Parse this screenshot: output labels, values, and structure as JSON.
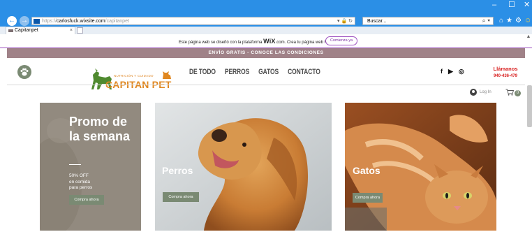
{
  "browser": {
    "url_scheme": "https://",
    "url_host": "carlosfuck.wixsite.com",
    "url_path": "/capitanpet",
    "search_placeholder": "Buscar...",
    "tab_title": "Capitanpet",
    "tab_close": "×",
    "win_min": "–",
    "win_max": "☐",
    "win_close": "✕",
    "addr_icons": "▾ 🔒 ↻",
    "search_icon": "⌕ ▾",
    "home_icon": "⌂",
    "star_icon": "★",
    "gear_icon": "⚙",
    "smiley_icon": "☺",
    "back_icon": "←",
    "forward_icon": "→"
  },
  "wix_banner": {
    "text_before": "Este página web se diseñó con la plataforma ",
    "brand": "WiX",
    "text_after": ".com. Crea tu página web hoy.",
    "button": "Comienza ya"
  },
  "shipping": {
    "text": "ENVÍO GRATIS - CONOCE LAS CONDICIONES"
  },
  "header": {
    "logo_subtitle": "NUTRICIÓN Y CUIDADO",
    "logo_title": "CAPITAN PET",
    "menu": [
      "DE TODO",
      "PERROS",
      "GATOS",
      "CONTACTO"
    ],
    "social": {
      "facebook": "f",
      "youtube": "▶",
      "instagram": "◎"
    },
    "call_label": "Llámanos",
    "call_phone": "940-436-479",
    "login_text": "Log In",
    "cart_count": "0",
    "cart_icon": "🛒"
  },
  "cards": {
    "promo": {
      "title": "Promo de la semana",
      "discount": "50% OFF",
      "detail_1": "en comida",
      "detail_2": "para perros",
      "cta": "Compra ahora"
    },
    "dogs": {
      "label": "Perros",
      "cta": "Compra ahora"
    },
    "cats": {
      "label": "Gatos",
      "cta": "Compra ahora"
    }
  },
  "colors": {
    "browser_blue": "#2b8fe6",
    "wix_purple": "#9c4fbf",
    "shipping_bar": "#a08288",
    "accent_green": "#7a8a73",
    "logo_orange": "#e0871f",
    "call_red": "#d82020",
    "promo_bg": "#928a7f"
  }
}
